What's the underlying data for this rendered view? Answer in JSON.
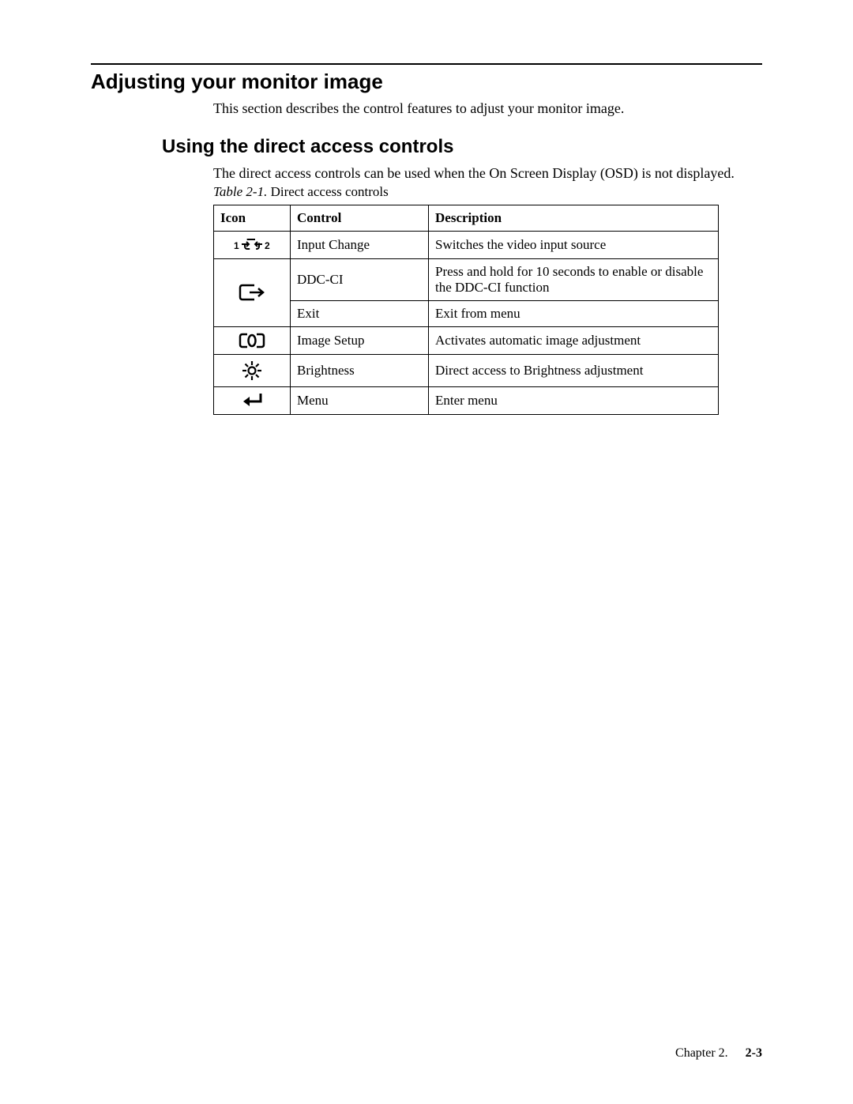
{
  "heading_main": "Adjusting your monitor image",
  "intro": "This section describes the control features to adjust your monitor image.",
  "heading_sub": "Using the direct access controls",
  "paragraph": "The direct access controls can be used when the On Screen Display (OSD) is not displayed.",
  "table_caption_label": "Table 2-1.",
  "table_caption_text": " Direct access controls",
  "table": {
    "headers": {
      "icon": "Icon",
      "control": "Control",
      "description": "Description"
    },
    "rows": [
      {
        "icon": "input-change-icon",
        "control": "Input Change",
        "description": "Switches the video input source"
      },
      {
        "icon": "exit-icon",
        "control": "DDC-CI",
        "description": "Press and hold for 10 seconds to enable or disable the DDC-CI function"
      },
      {
        "icon": "",
        "control": "Exit",
        "description": "Exit from menu"
      },
      {
        "icon": "image-setup-icon",
        "control": "Image Setup",
        "description": "Activates automatic image adjustment"
      },
      {
        "icon": "brightness-icon",
        "control": "Brightness",
        "description": "Direct access to Brightness adjustment"
      },
      {
        "icon": "menu-icon",
        "control": "Menu",
        "description": "Enter menu"
      }
    ]
  },
  "footer": {
    "chapter": "Chapter 2.",
    "page": "2-3"
  }
}
